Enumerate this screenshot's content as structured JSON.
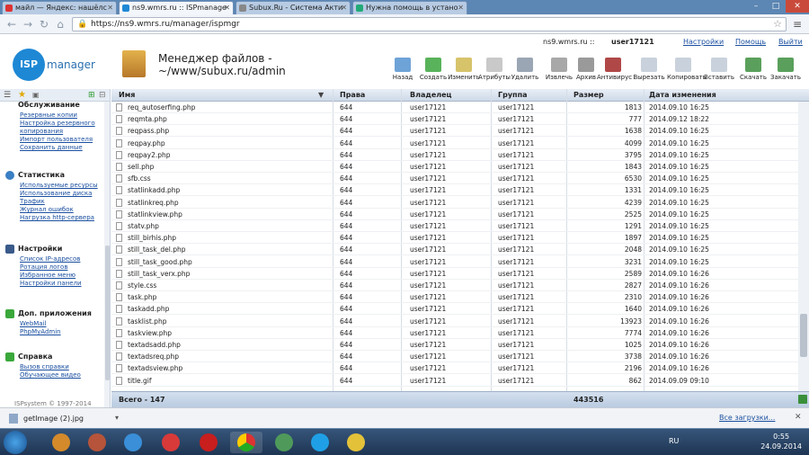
{
  "browser": {
    "tabs": [
      {
        "label": "майл — Яндекс: нашёлс",
        "active": false
      },
      {
        "label": "ns9.wmrs.ru :: ISPmanage",
        "active": true
      },
      {
        "label": "Subux.Ru - Система Акти",
        "active": false
      },
      {
        "label": "Нужна помощь в устано",
        "active": false
      }
    ],
    "url": "https://ns9.wmrs.ru/manager/ispmgr"
  },
  "header": {
    "logo_isp": "ISP",
    "logo_manager": "manager",
    "title_line1": "Менеджер файлов -",
    "title_line2": "~/www/subux.ru/admin",
    "server": "ns9.wmrs.ru ::",
    "user": "user17121",
    "settings": "Настройки",
    "help": "Помощь",
    "logout": "Выйти"
  },
  "toolbar": [
    "Назад",
    "Создать",
    "Изменить",
    "Атрибуты",
    "Удалить",
    "Извлечь",
    "Архив",
    "Антивирус",
    "Вырезать",
    "Копировать",
    "Вставить",
    "Скачать",
    "Закачать"
  ],
  "sidebar": {
    "sections": [
      {
        "title": "Обслуживание",
        "items": [
          "Резервные копии",
          "Настройка резервного",
          "копирования",
          "Импорт пользователя",
          "Сохранить данные"
        ]
      },
      {
        "title": "Статистика",
        "items": [
          "Используемые ресурсы",
          "Использование диска",
          "Трафик",
          "Журнал ошибок",
          "Нагрузка http-сервера"
        ]
      },
      {
        "title": "Настройки",
        "items": [
          "Список IP-адресов",
          "Ротация логов",
          "Избранное меню",
          "Настройки панели"
        ]
      },
      {
        "title": "Доп. приложения",
        "items": [
          "WebMail",
          "PhpMyAdmin"
        ]
      },
      {
        "title": "Справка",
        "items": [
          "Вызов справки",
          "Обучающее видео"
        ]
      }
    ],
    "copyright": "ISPsystem © 1997-2014"
  },
  "table": {
    "columns": [
      "Имя",
      "Права",
      "Владелец",
      "Группа",
      "Размер",
      "Дата изменения"
    ],
    "rows": [
      [
        "req_autoserfing.php",
        "644",
        "user17121",
        "user17121",
        "1813",
        "2014.09.10 16:25"
      ],
      [
        "reqmta.php",
        "644",
        "user17121",
        "user17121",
        "777",
        "2014.09.12 18:22"
      ],
      [
        "reqpass.php",
        "644",
        "user17121",
        "user17121",
        "1638",
        "2014.09.10 16:25"
      ],
      [
        "reqpay.php",
        "644",
        "user17121",
        "user17121",
        "4099",
        "2014.09.10 16:25"
      ],
      [
        "reqpay2.php",
        "644",
        "user17121",
        "user17121",
        "3795",
        "2014.09.10 16:25"
      ],
      [
        "sell.php",
        "644",
        "user17121",
        "user17121",
        "1843",
        "2014.09.10 16:25"
      ],
      [
        "sfb.css",
        "644",
        "user17121",
        "user17121",
        "6530",
        "2014.09.10 16:25"
      ],
      [
        "statlinkadd.php",
        "644",
        "user17121",
        "user17121",
        "1331",
        "2014.09.10 16:25"
      ],
      [
        "statlinkreq.php",
        "644",
        "user17121",
        "user17121",
        "4239",
        "2014.09.10 16:25"
      ],
      [
        "statlinkview.php",
        "644",
        "user17121",
        "user17121",
        "2525",
        "2014.09.10 16:25"
      ],
      [
        "statv.php",
        "644",
        "user17121",
        "user17121",
        "1291",
        "2014.09.10 16:25"
      ],
      [
        "still_birhis.php",
        "644",
        "user17121",
        "user17121",
        "1897",
        "2014.09.10 16:25"
      ],
      [
        "still_task_del.php",
        "644",
        "user17121",
        "user17121",
        "2048",
        "2014.09.10 16:25"
      ],
      [
        "still_task_good.php",
        "644",
        "user17121",
        "user17121",
        "3231",
        "2014.09.10 16:25"
      ],
      [
        "still_task_verx.php",
        "644",
        "user17121",
        "user17121",
        "2589",
        "2014.09.10 16:26"
      ],
      [
        "style.css",
        "644",
        "user17121",
        "user17121",
        "2827",
        "2014.09.10 16:26"
      ],
      [
        "task.php",
        "644",
        "user17121",
        "user17121",
        "2310",
        "2014.09.10 16:26"
      ],
      [
        "taskadd.php",
        "644",
        "user17121",
        "user17121",
        "1640",
        "2014.09.10 16:26"
      ],
      [
        "tasklist.php",
        "644",
        "user17121",
        "user17121",
        "13923",
        "2014.09.10 16:26"
      ],
      [
        "taskview.php",
        "644",
        "user17121",
        "user17121",
        "7774",
        "2014.09.10 16:26"
      ],
      [
        "textadsadd.php",
        "644",
        "user17121",
        "user17121",
        "1025",
        "2014.09.10 16:26"
      ],
      [
        "textadsreq.php",
        "644",
        "user17121",
        "user17121",
        "3738",
        "2014.09.10 16:26"
      ],
      [
        "textadsview.php",
        "644",
        "user17121",
        "user17121",
        "2196",
        "2014.09.10 16:26"
      ],
      [
        "title.gif",
        "644",
        "user17121",
        "user17121",
        "862",
        "2014.09.09 09:10"
      ]
    ],
    "total_label": "Всего - 147",
    "total_size": "443516"
  },
  "downloads": {
    "file": "getImage (2).jpg",
    "all": "Все загрузки..."
  },
  "taskbar": {
    "lang": "RU",
    "time": "0:55",
    "date": "24.09.2014"
  }
}
